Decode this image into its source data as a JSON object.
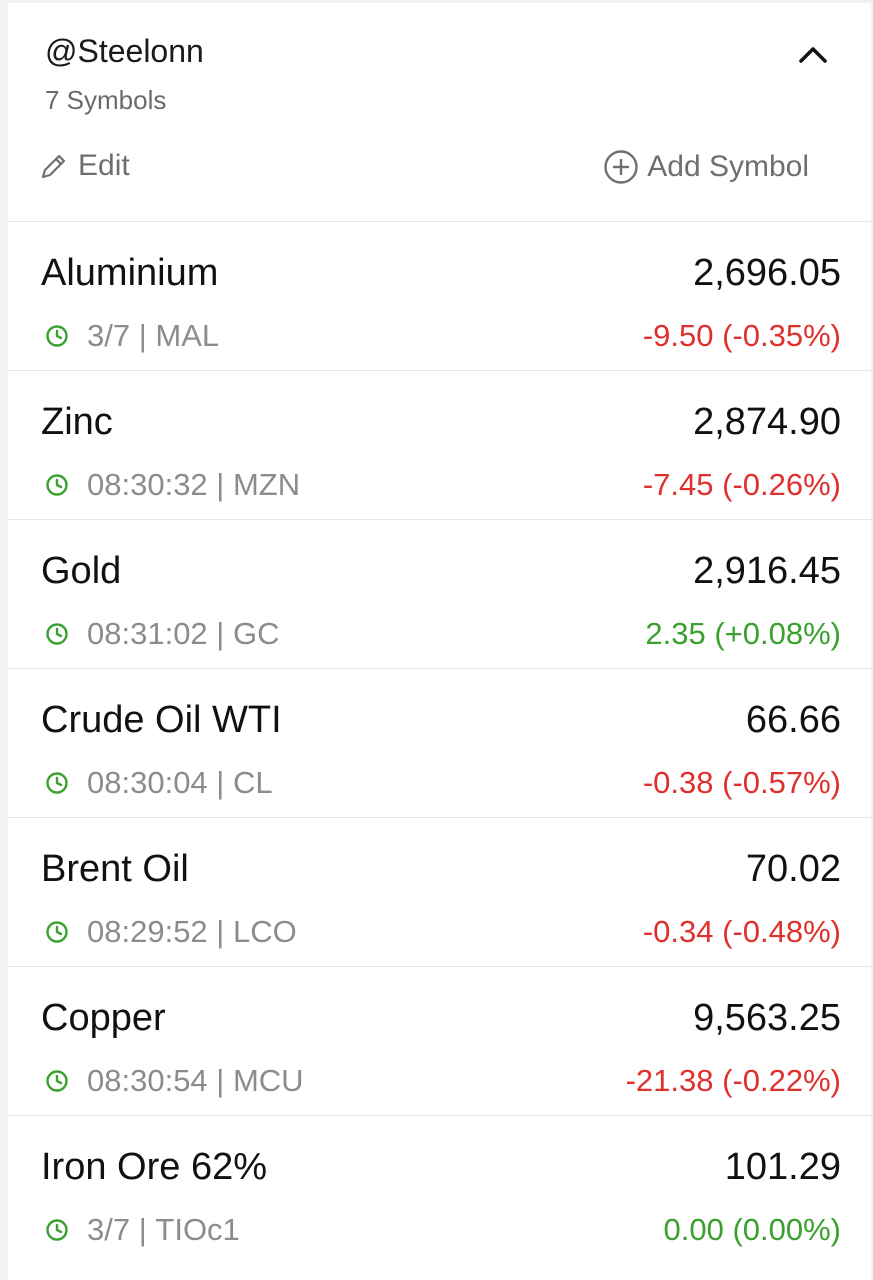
{
  "header": {
    "list_name": "@Steelonn",
    "symbol_count": "7 Symbols",
    "edit_label": "Edit",
    "add_symbol_label": "Add Symbol"
  },
  "colors": {
    "negative": "#e0302e",
    "positive": "#3aa12f",
    "clock_icon": "#3aa12f"
  },
  "rows": [
    {
      "name": "Aluminium",
      "price": "2,696.05",
      "time": "3/7",
      "ticker": "MAL",
      "change": "-9.50 (-0.35%)",
      "direction": "neg"
    },
    {
      "name": "Zinc",
      "price": "2,874.90",
      "time": "08:30:32",
      "ticker": "MZN",
      "change": "-7.45 (-0.26%)",
      "direction": "neg"
    },
    {
      "name": "Gold",
      "price": "2,916.45",
      "time": "08:31:02",
      "ticker": "GC",
      "change": "2.35 (+0.08%)",
      "direction": "pos"
    },
    {
      "name": "Crude Oil WTI",
      "price": "66.66",
      "time": "08:30:04",
      "ticker": "CL",
      "change": "-0.38 (-0.57%)",
      "direction": "neg"
    },
    {
      "name": "Brent Oil",
      "price": "70.02",
      "time": "08:29:52",
      "ticker": "LCO",
      "change": "-0.34 (-0.48%)",
      "direction": "neg"
    },
    {
      "name": "Copper",
      "price": "9,563.25",
      "time": "08:30:54",
      "ticker": "MCU",
      "change": "-21.38 (-0.22%)",
      "direction": "neg"
    },
    {
      "name": "Iron Ore 62%",
      "price": "101.29",
      "time": "3/7",
      "ticker": "TIOc1",
      "change": "0.00 (0.00%)",
      "direction": "pos"
    }
  ]
}
